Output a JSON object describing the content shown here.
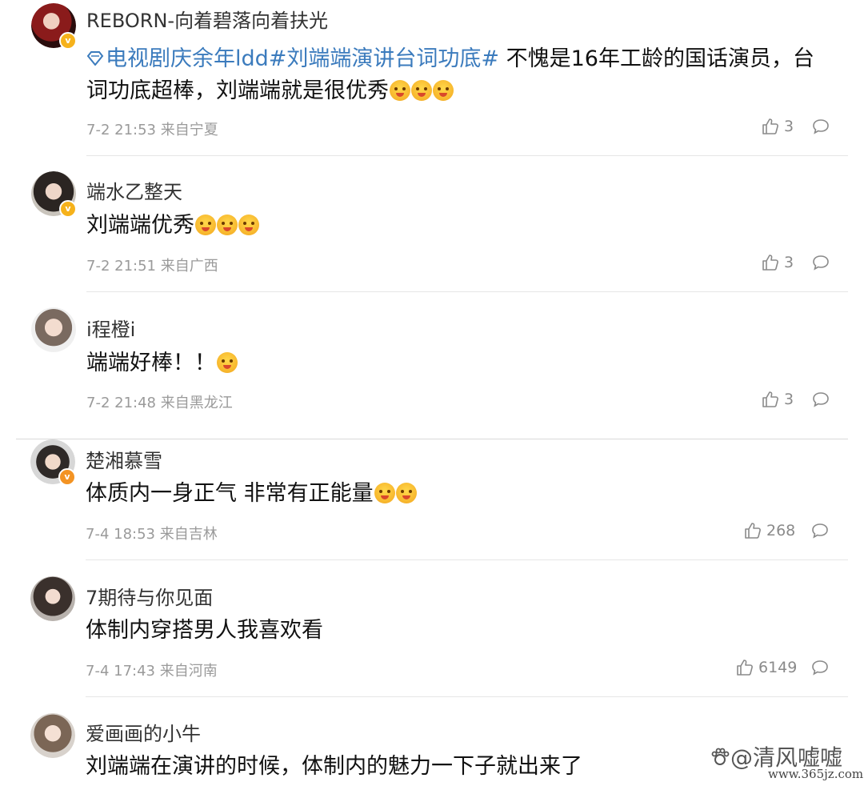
{
  "comments": [
    {
      "username": "REBORN-向着碧落向着扶光",
      "topics": [
        "电视剧庆余年ldd",
        "#刘端端演讲台词功底#"
      ],
      "text_line1": " 不愧是16年工龄的国话演员，台",
      "text_line2": "词功底超棒，刘端端就是很优秀",
      "emoji_count": 3,
      "date": "7-2 21:53",
      "location": "来自宁夏",
      "likes": "3",
      "badge_color": "#f6b21b"
    },
    {
      "username": "端水乙整天",
      "text": "刘端端优秀",
      "emoji_count": 3,
      "date": "7-2 21:51",
      "location": "来自广西",
      "likes": "3",
      "badge_color": "#f6b21b"
    },
    {
      "username": "i程橙i",
      "text": "端端好棒！！",
      "emoji_count": 1,
      "date": "7-2 21:48",
      "location": "来自黑龙江",
      "likes": "3"
    },
    {
      "username": "楚湘慕雪",
      "text": "体质内一身正气 非常有正能量",
      "emoji_count": 2,
      "date": "7-4 18:53",
      "location": "来自吉林",
      "likes": "268",
      "badge_color": "#f39323"
    },
    {
      "username": "7期待与你见面",
      "text": "体制内穿搭男人我喜欢看",
      "emoji_count": 0,
      "date": "7-4 17:43",
      "location": "来自河南",
      "likes": "6149"
    },
    {
      "username": "爱画画的小牛",
      "text": "刘端端在演讲的时候，体制内的魅力一下子就出来了",
      "emoji_count": 0
    }
  ],
  "watermark": {
    "handle": "@清风嘘嘘",
    "url": "www.365jz.com"
  },
  "icons": {
    "like": "thumbs-up-icon",
    "reply": "comment-bubble-icon",
    "topic": "diamond-icon"
  }
}
